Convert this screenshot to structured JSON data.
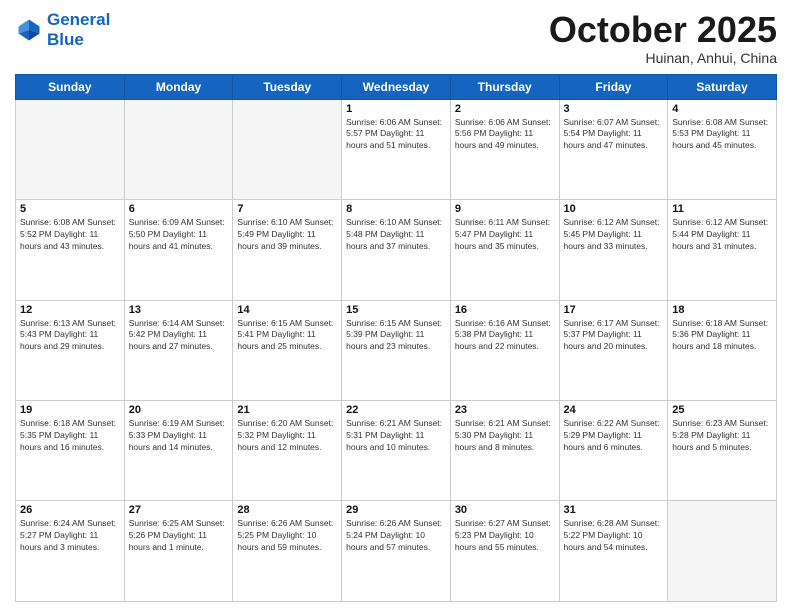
{
  "header": {
    "logo_line1": "General",
    "logo_line2": "Blue",
    "month": "October 2025",
    "location": "Huinan, Anhui, China"
  },
  "days_of_week": [
    "Sunday",
    "Monday",
    "Tuesday",
    "Wednesday",
    "Thursday",
    "Friday",
    "Saturday"
  ],
  "weeks": [
    [
      {
        "day": "",
        "info": ""
      },
      {
        "day": "",
        "info": ""
      },
      {
        "day": "",
        "info": ""
      },
      {
        "day": "1",
        "info": "Sunrise: 6:06 AM\nSunset: 5:57 PM\nDaylight: 11 hours\nand 51 minutes."
      },
      {
        "day": "2",
        "info": "Sunrise: 6:06 AM\nSunset: 5:56 PM\nDaylight: 11 hours\nand 49 minutes."
      },
      {
        "day": "3",
        "info": "Sunrise: 6:07 AM\nSunset: 5:54 PM\nDaylight: 11 hours\nand 47 minutes."
      },
      {
        "day": "4",
        "info": "Sunrise: 6:08 AM\nSunset: 5:53 PM\nDaylight: 11 hours\nand 45 minutes."
      }
    ],
    [
      {
        "day": "5",
        "info": "Sunrise: 6:08 AM\nSunset: 5:52 PM\nDaylight: 11 hours\nand 43 minutes."
      },
      {
        "day": "6",
        "info": "Sunrise: 6:09 AM\nSunset: 5:50 PM\nDaylight: 11 hours\nand 41 minutes."
      },
      {
        "day": "7",
        "info": "Sunrise: 6:10 AM\nSunset: 5:49 PM\nDaylight: 11 hours\nand 39 minutes."
      },
      {
        "day": "8",
        "info": "Sunrise: 6:10 AM\nSunset: 5:48 PM\nDaylight: 11 hours\nand 37 minutes."
      },
      {
        "day": "9",
        "info": "Sunrise: 6:11 AM\nSunset: 5:47 PM\nDaylight: 11 hours\nand 35 minutes."
      },
      {
        "day": "10",
        "info": "Sunrise: 6:12 AM\nSunset: 5:45 PM\nDaylight: 11 hours\nand 33 minutes."
      },
      {
        "day": "11",
        "info": "Sunrise: 6:12 AM\nSunset: 5:44 PM\nDaylight: 11 hours\nand 31 minutes."
      }
    ],
    [
      {
        "day": "12",
        "info": "Sunrise: 6:13 AM\nSunset: 5:43 PM\nDaylight: 11 hours\nand 29 minutes."
      },
      {
        "day": "13",
        "info": "Sunrise: 6:14 AM\nSunset: 5:42 PM\nDaylight: 11 hours\nand 27 minutes."
      },
      {
        "day": "14",
        "info": "Sunrise: 6:15 AM\nSunset: 5:41 PM\nDaylight: 11 hours\nand 25 minutes."
      },
      {
        "day": "15",
        "info": "Sunrise: 6:15 AM\nSunset: 5:39 PM\nDaylight: 11 hours\nand 23 minutes."
      },
      {
        "day": "16",
        "info": "Sunrise: 6:16 AM\nSunset: 5:38 PM\nDaylight: 11 hours\nand 22 minutes."
      },
      {
        "day": "17",
        "info": "Sunrise: 6:17 AM\nSunset: 5:37 PM\nDaylight: 11 hours\nand 20 minutes."
      },
      {
        "day": "18",
        "info": "Sunrise: 6:18 AM\nSunset: 5:36 PM\nDaylight: 11 hours\nand 18 minutes."
      }
    ],
    [
      {
        "day": "19",
        "info": "Sunrise: 6:18 AM\nSunset: 5:35 PM\nDaylight: 11 hours\nand 16 minutes."
      },
      {
        "day": "20",
        "info": "Sunrise: 6:19 AM\nSunset: 5:33 PM\nDaylight: 11 hours\nand 14 minutes."
      },
      {
        "day": "21",
        "info": "Sunrise: 6:20 AM\nSunset: 5:32 PM\nDaylight: 11 hours\nand 12 minutes."
      },
      {
        "day": "22",
        "info": "Sunrise: 6:21 AM\nSunset: 5:31 PM\nDaylight: 11 hours\nand 10 minutes."
      },
      {
        "day": "23",
        "info": "Sunrise: 6:21 AM\nSunset: 5:30 PM\nDaylight: 11 hours\nand 8 minutes."
      },
      {
        "day": "24",
        "info": "Sunrise: 6:22 AM\nSunset: 5:29 PM\nDaylight: 11 hours\nand 6 minutes."
      },
      {
        "day": "25",
        "info": "Sunrise: 6:23 AM\nSunset: 5:28 PM\nDaylight: 11 hours\nand 5 minutes."
      }
    ],
    [
      {
        "day": "26",
        "info": "Sunrise: 6:24 AM\nSunset: 5:27 PM\nDaylight: 11 hours\nand 3 minutes."
      },
      {
        "day": "27",
        "info": "Sunrise: 6:25 AM\nSunset: 5:26 PM\nDaylight: 11 hours\nand 1 minute."
      },
      {
        "day": "28",
        "info": "Sunrise: 6:26 AM\nSunset: 5:25 PM\nDaylight: 10 hours\nand 59 minutes."
      },
      {
        "day": "29",
        "info": "Sunrise: 6:26 AM\nSunset: 5:24 PM\nDaylight: 10 hours\nand 57 minutes."
      },
      {
        "day": "30",
        "info": "Sunrise: 6:27 AM\nSunset: 5:23 PM\nDaylight: 10 hours\nand 55 minutes."
      },
      {
        "day": "31",
        "info": "Sunrise: 6:28 AM\nSunset: 5:22 PM\nDaylight: 10 hours\nand 54 minutes."
      },
      {
        "day": "",
        "info": ""
      }
    ]
  ]
}
